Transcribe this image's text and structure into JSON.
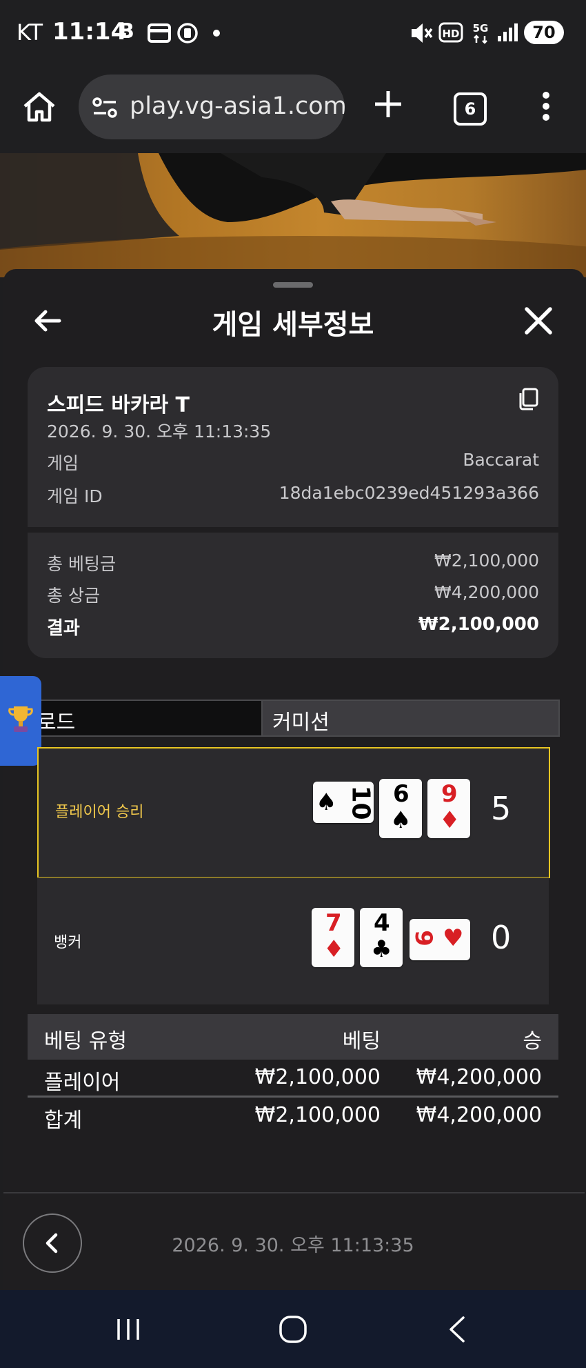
{
  "status_bar": {
    "carrier": "KT",
    "time": "11:14",
    "battery": "70",
    "icons": [
      "b-app-icon",
      "card-icon",
      "wallet-icon",
      "dot-icon",
      "mute-icon",
      "hd-icon",
      "5g-icon",
      "signal-icon"
    ]
  },
  "browser": {
    "url": "play.vg-asia1.com",
    "tab_count": "6"
  },
  "sheet": {
    "title": "게임 세부정보"
  },
  "details": {
    "game_name": "스피드 바카라 T",
    "datetime": "2026. 9. 30. 오후 11:13:35",
    "rows": [
      {
        "label": "게임",
        "value": "Baccarat"
      },
      {
        "label": "게임 ID",
        "value": "18da1ebc0239ed451293a366"
      }
    ],
    "totals": [
      {
        "label": "총 베팅금",
        "value": "₩2,100,000"
      },
      {
        "label": "총 상금",
        "value": "₩4,200,000"
      },
      {
        "label": "결과",
        "value": "₩2,100,000"
      }
    ]
  },
  "tabs": [
    {
      "label": "로드"
    },
    {
      "label": "커미션"
    }
  ],
  "hands": {
    "player": {
      "label": "플레이어 승리",
      "score": "5",
      "label_color": "#f2c94c",
      "cards": [
        {
          "rank": "10",
          "suit": "♠",
          "color": "black",
          "rotated": true
        },
        {
          "rank": "6",
          "suit": "♠",
          "color": "black",
          "rotated": false
        },
        {
          "rank": "9",
          "suit": "♦",
          "color": "red",
          "rotated": false
        }
      ]
    },
    "banker": {
      "label": "뱅커",
      "score": "0",
      "cards": [
        {
          "rank": "7",
          "suit": "♦",
          "color": "red",
          "rotated": false
        },
        {
          "rank": "4",
          "suit": "♣",
          "color": "black",
          "rotated": false
        },
        {
          "rank": "9",
          "suit": "♥",
          "color": "red",
          "rotated": true
        }
      ]
    }
  },
  "bet_table": {
    "headers": [
      "베팅 유형",
      "베팅",
      "승"
    ],
    "rows": [
      [
        "플레이어",
        "₩2,100,000",
        "₩4,200,000"
      ]
    ],
    "total": [
      "합계",
      "₩2,100,000",
      "₩4,200,000"
    ]
  },
  "footer": {
    "datetime": "2026. 9. 30. 오후 11:13:35"
  },
  "colors": {
    "highlight_border": "#e8c622",
    "card_red": "#d81f24",
    "trophy_tab": "#2f66d4"
  }
}
